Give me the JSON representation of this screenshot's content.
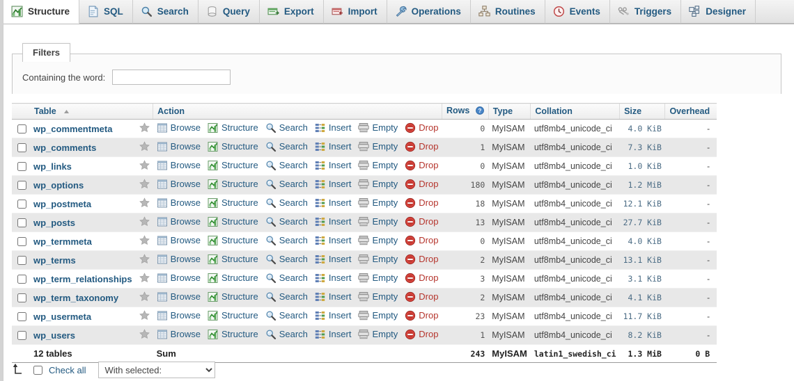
{
  "tabs": [
    {
      "label": "Structure",
      "icon": "structure-icon",
      "active": true
    },
    {
      "label": "SQL",
      "icon": "sql-icon",
      "active": false
    },
    {
      "label": "Search",
      "icon": "search-icon",
      "active": false
    },
    {
      "label": "Query",
      "icon": "query-icon",
      "active": false
    },
    {
      "label": "Export",
      "icon": "export-icon",
      "active": false
    },
    {
      "label": "Import",
      "icon": "import-icon",
      "active": false
    },
    {
      "label": "Operations",
      "icon": "wrench-icon",
      "active": false
    },
    {
      "label": "Routines",
      "icon": "routines-icon",
      "active": false
    },
    {
      "label": "Events",
      "icon": "clock-icon",
      "active": false
    },
    {
      "label": "Triggers",
      "icon": "triggers-icon",
      "active": false
    },
    {
      "label": "Designer",
      "icon": "designer-icon",
      "active": false
    }
  ],
  "filters": {
    "legend": "Filters",
    "label": "Containing the word:",
    "value": "",
    "placeholder": ""
  },
  "table": {
    "headers": {
      "table": "Table",
      "action": "Action",
      "rows": "Rows",
      "type": "Type",
      "collation": "Collation",
      "size": "Size",
      "overhead": "Overhead"
    },
    "sort_indicator": "ascending",
    "actions": [
      "Browse",
      "Structure",
      "Search",
      "Insert",
      "Empty",
      "Drop"
    ],
    "rows": [
      {
        "name": "wp_commentmeta",
        "rows": "0",
        "type": "MyISAM",
        "collation": "utf8mb4_unicode_ci",
        "size": "4.0 KiB",
        "overhead": "-"
      },
      {
        "name": "wp_comments",
        "rows": "1",
        "type": "MyISAM",
        "collation": "utf8mb4_unicode_ci",
        "size": "7.3 KiB",
        "overhead": "-"
      },
      {
        "name": "wp_links",
        "rows": "0",
        "type": "MyISAM",
        "collation": "utf8mb4_unicode_ci",
        "size": "1.0 KiB",
        "overhead": "-"
      },
      {
        "name": "wp_options",
        "rows": "180",
        "type": "MyISAM",
        "collation": "utf8mb4_unicode_ci",
        "size": "1.2 MiB",
        "overhead": "-"
      },
      {
        "name": "wp_postmeta",
        "rows": "18",
        "type": "MyISAM",
        "collation": "utf8mb4_unicode_ci",
        "size": "12.1 KiB",
        "overhead": "-"
      },
      {
        "name": "wp_posts",
        "rows": "13",
        "type": "MyISAM",
        "collation": "utf8mb4_unicode_ci",
        "size": "27.7 KiB",
        "overhead": "-"
      },
      {
        "name": "wp_termmeta",
        "rows": "0",
        "type": "MyISAM",
        "collation": "utf8mb4_unicode_ci",
        "size": "4.0 KiB",
        "overhead": "-"
      },
      {
        "name": "wp_terms",
        "rows": "2",
        "type": "MyISAM",
        "collation": "utf8mb4_unicode_ci",
        "size": "13.1 KiB",
        "overhead": "-"
      },
      {
        "name": "wp_term_relationships",
        "rows": "3",
        "type": "MyISAM",
        "collation": "utf8mb4_unicode_ci",
        "size": "3.1 KiB",
        "overhead": "-"
      },
      {
        "name": "wp_term_taxonomy",
        "rows": "2",
        "type": "MyISAM",
        "collation": "utf8mb4_unicode_ci",
        "size": "4.1 KiB",
        "overhead": "-"
      },
      {
        "name": "wp_usermeta",
        "rows": "23",
        "type": "MyISAM",
        "collation": "utf8mb4_unicode_ci",
        "size": "11.7 KiB",
        "overhead": "-"
      },
      {
        "name": "wp_users",
        "rows": "1",
        "type": "MyISAM",
        "collation": "utf8mb4_unicode_ci",
        "size": "8.2 KiB",
        "overhead": "-"
      }
    ],
    "summary": {
      "count_label": "12 tables",
      "sum_label": "Sum",
      "rows": "243",
      "type": "MyISAM",
      "collation": "latin1_swedish_ci",
      "size": "1.3 MiB",
      "overhead": "0 B"
    }
  },
  "footer": {
    "check_all": "Check all",
    "with_selected": "With selected:",
    "with_selected_options": [
      "With selected:"
    ]
  },
  "colors": {
    "link": "#235a81",
    "row_alt": "#e8e8e8",
    "drop_red": "#cc3333",
    "tab_active_bg": "#ffffff"
  }
}
